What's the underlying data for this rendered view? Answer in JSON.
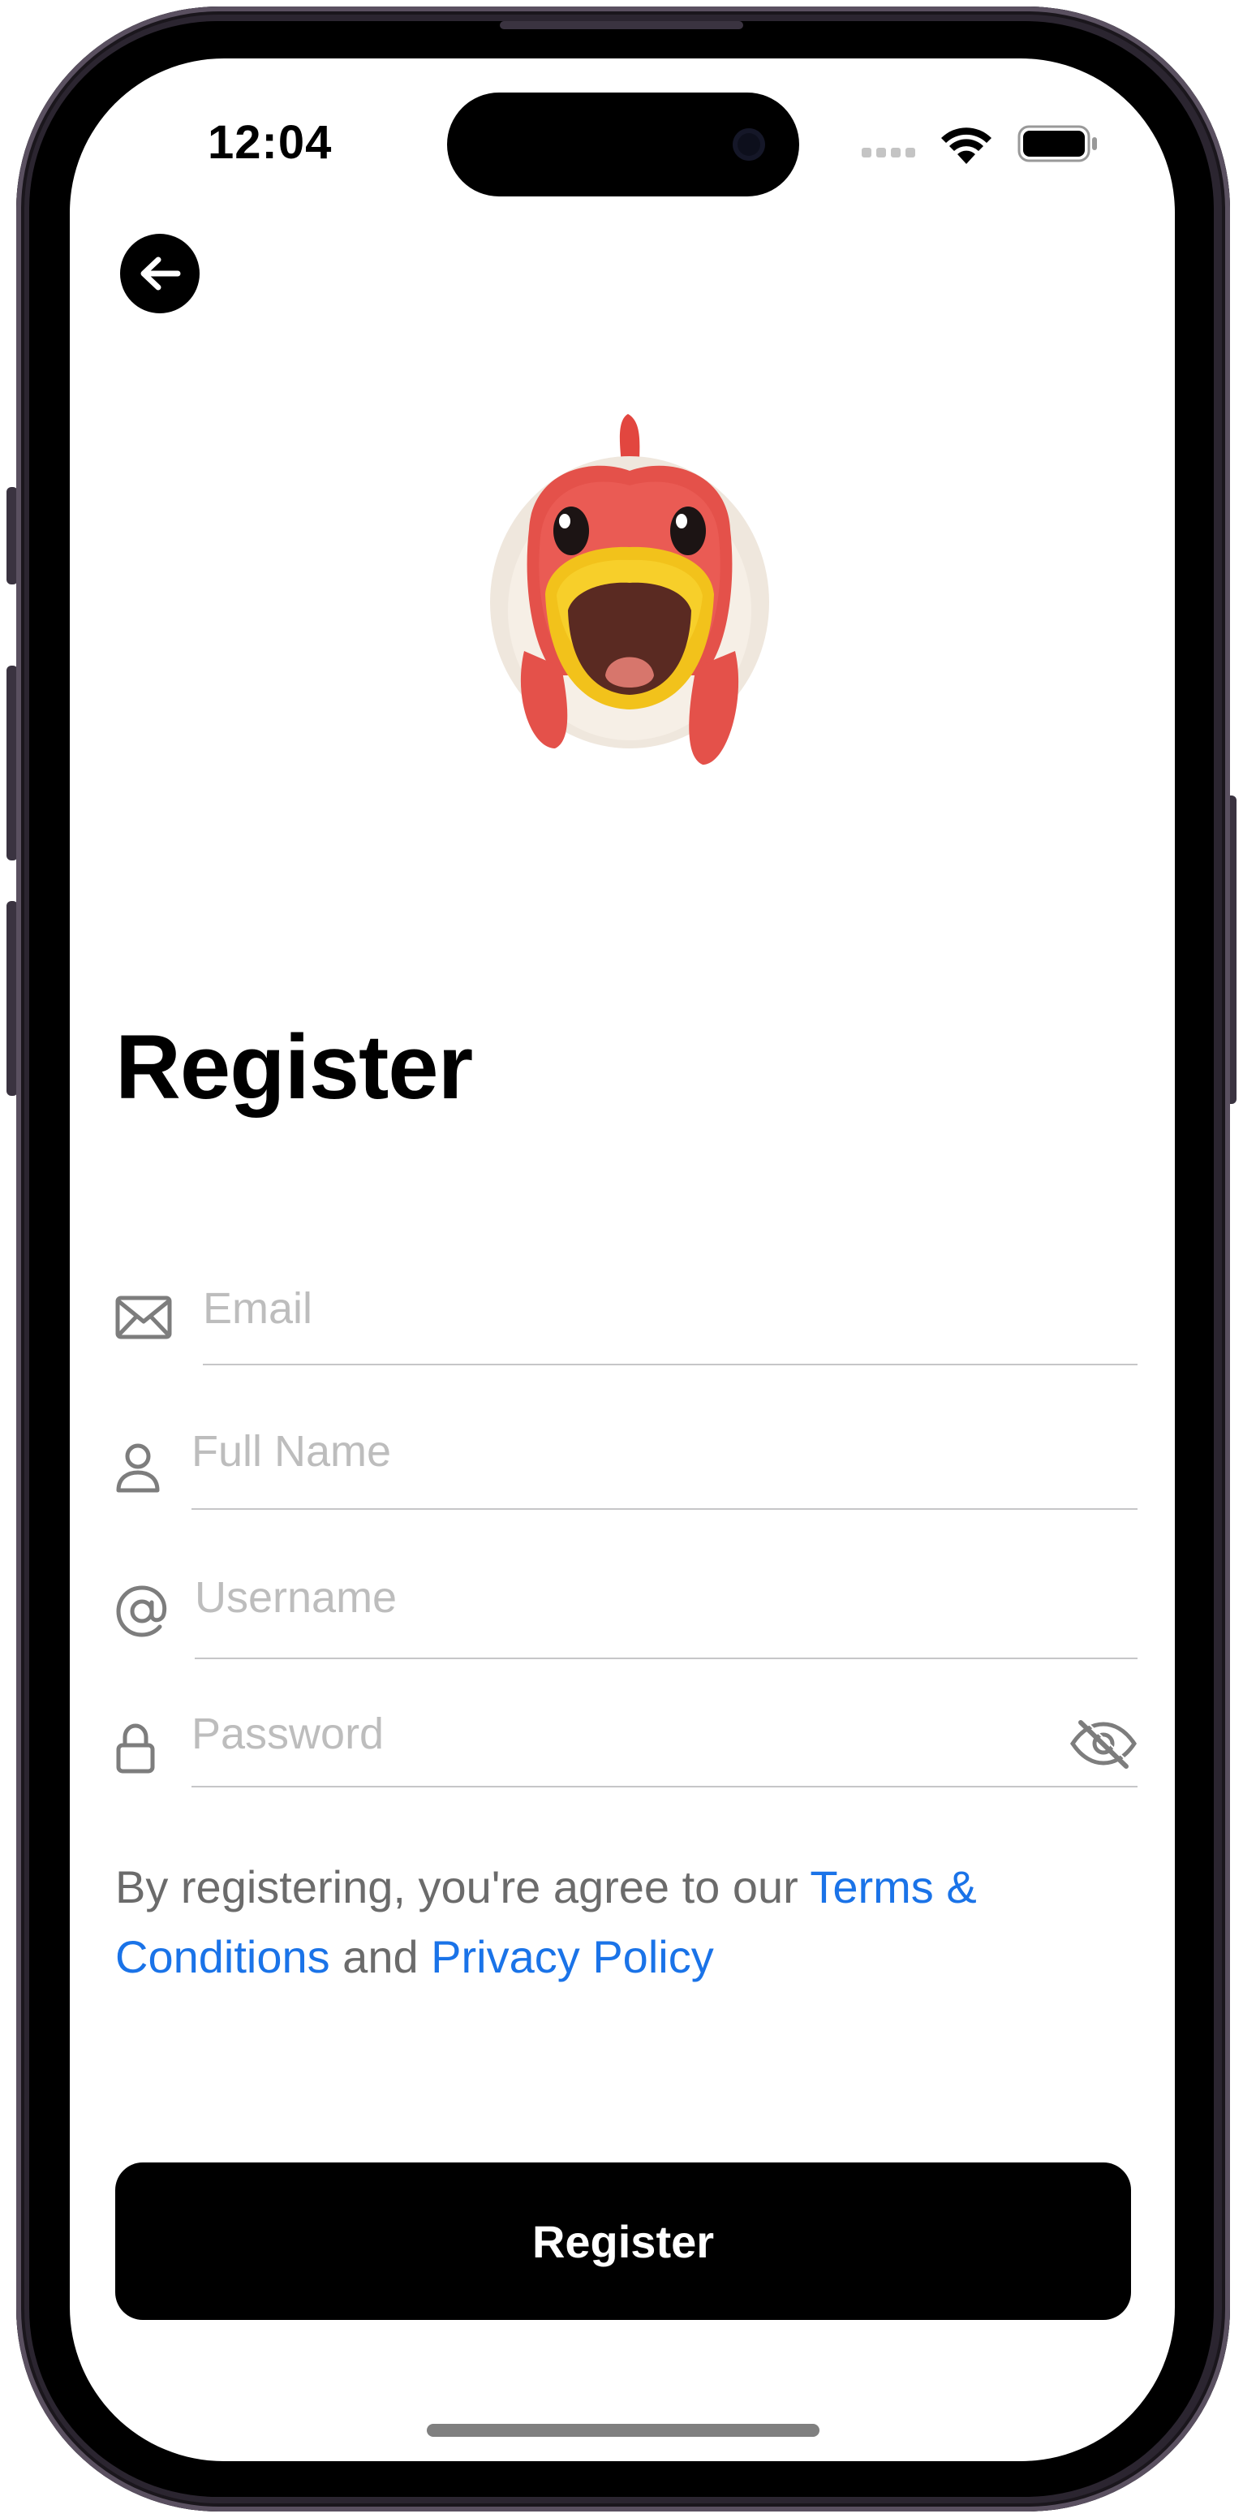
{
  "status_bar": {
    "time": "12:04"
  },
  "nav": {
    "back_icon": "arrow-left-icon"
  },
  "header": {
    "avatar_icon": "chicken-memoji",
    "title": "Register"
  },
  "form": {
    "email": {
      "placeholder": "Email",
      "value": "",
      "icon": "envelope-icon"
    },
    "full_name": {
      "placeholder": "Full Name",
      "value": "",
      "icon": "person-icon"
    },
    "username": {
      "placeholder": "Username",
      "value": "",
      "icon": "at-sign-icon"
    },
    "password": {
      "placeholder": "Password",
      "value": "",
      "icon": "lock-icon",
      "toggle_icon": "eye-slash-icon"
    }
  },
  "terms": {
    "prefix": "By registering, you're agree to our ",
    "terms_link": "Terms & Conditions",
    "middle": " and ",
    "privacy_link": "Privacy Policy"
  },
  "actions": {
    "register_label": "Register"
  },
  "colors": {
    "link": "#1a73e8",
    "button_bg": "#000000",
    "placeholder": "#bdbdbd"
  }
}
